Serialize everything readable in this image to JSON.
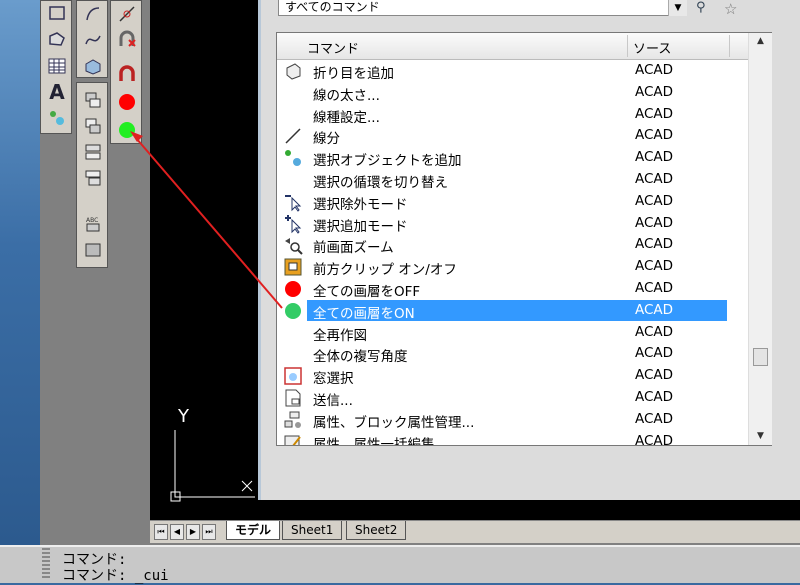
{
  "dialog": {
    "filter_value": "すべてのコマンド",
    "header": {
      "command_col": "コマンド",
      "source_col": "ソース"
    },
    "rows": [
      {
        "name": "折り目を追加",
        "source": "ACAD",
        "icon": "crease-icon",
        "selected": false
      },
      {
        "name": "線の太さ...",
        "source": "ACAD",
        "icon": "",
        "selected": false
      },
      {
        "name": "線種設定...",
        "source": "ACAD",
        "icon": "",
        "selected": false
      },
      {
        "name": "線分",
        "source": "ACAD",
        "icon": "line-icon",
        "selected": false
      },
      {
        "name": "選択オブジェクトを追加",
        "source": "ACAD",
        "icon": "add-selected-icon",
        "selected": false
      },
      {
        "name": "選択の循環を切り替え",
        "source": "ACAD",
        "icon": "",
        "selected": false
      },
      {
        "name": "選択除外モード",
        "source": "ACAD",
        "icon": "select-remove-icon",
        "selected": false
      },
      {
        "name": "選択追加モード",
        "source": "ACAD",
        "icon": "select-add-icon",
        "selected": false
      },
      {
        "name": "前画面ズーム",
        "source": "ACAD",
        "icon": "zoom-previous-icon",
        "selected": false
      },
      {
        "name": "前方クリップ オン/オフ",
        "source": "ACAD",
        "icon": "front-clip-icon",
        "selected": false
      },
      {
        "name": "全ての画層をOFF",
        "source": "ACAD",
        "icon": "red-circle-icon",
        "selected": false
      },
      {
        "name": "全ての画層をON",
        "source": "ACAD",
        "icon": "green-circle-icon",
        "selected": true
      },
      {
        "name": "全再作図",
        "source": "ACAD",
        "icon": "",
        "selected": false
      },
      {
        "name": "全体の複写角度",
        "source": "ACAD",
        "icon": "",
        "selected": false
      },
      {
        "name": "窓選択",
        "source": "ACAD",
        "icon": "window-select-icon",
        "selected": false
      },
      {
        "name": "送信...",
        "source": "ACAD",
        "icon": "send-icon",
        "selected": false
      },
      {
        "name": "属性、ブロック属性管理...",
        "source": "ACAD",
        "icon": "block-attr-icon",
        "selected": false
      },
      {
        "name": "属性、属性一括編集...",
        "source": "ACAD",
        "icon": "attr-edit-icon",
        "selected": false
      }
    ]
  },
  "tabs": {
    "model": "モデル",
    "sheet1": "Sheet1",
    "sheet2": "Sheet2"
  },
  "command_line": {
    "line1": "コマンド:",
    "line2": "コマンド: _cui"
  },
  "ucs": {
    "y_label": "Y"
  },
  "colors": {
    "selection": "#3399ff",
    "arrow": "#e02020",
    "layer_off": "#ff0000",
    "layer_on": "#22dd44"
  }
}
